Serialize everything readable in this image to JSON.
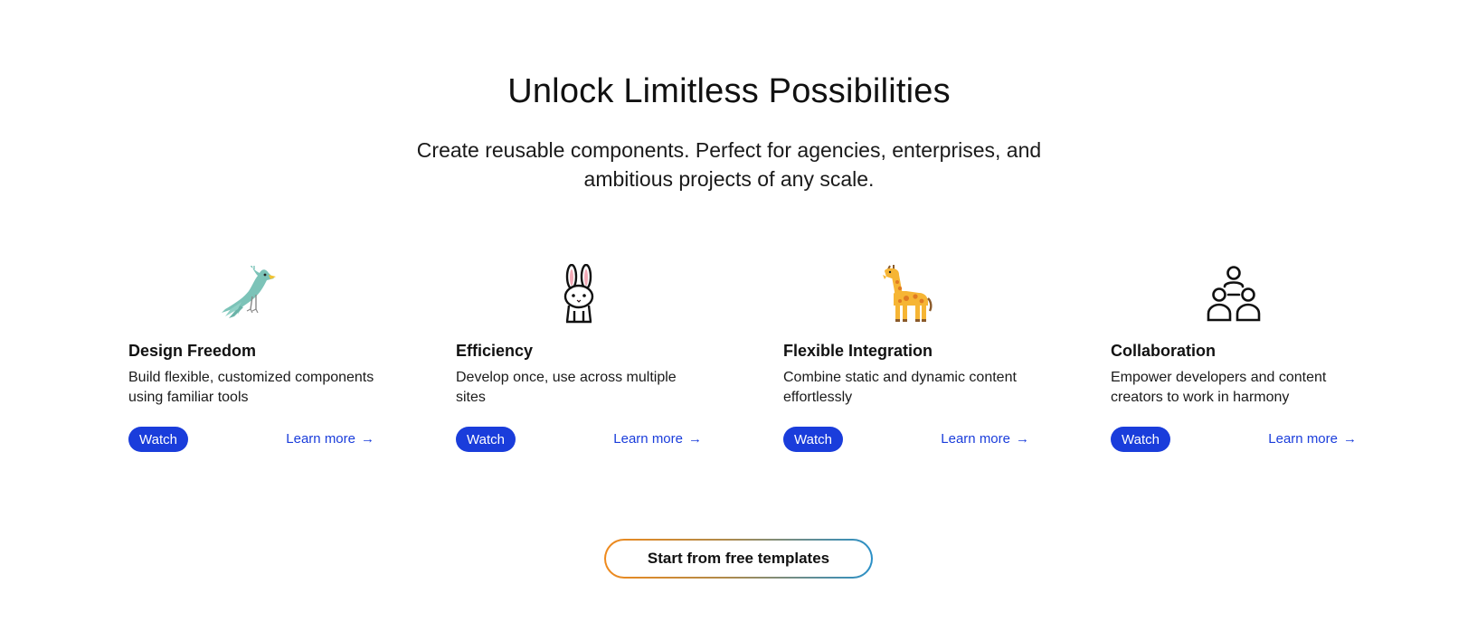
{
  "hero": {
    "title": "Unlock Limitless Possibilities",
    "subtitle": "Create reusable components. Perfect for agencies, enterprises, and ambitious projects of any scale."
  },
  "features": [
    {
      "icon": "bird-icon",
      "title": "Design Freedom",
      "description": "Build flexible, customized components using familiar tools",
      "watch_label": "Watch",
      "learn_label": "Learn more"
    },
    {
      "icon": "rabbit-icon",
      "title": "Efficiency",
      "description": "Develop once, use across multiple sites",
      "watch_label": "Watch",
      "learn_label": "Learn more"
    },
    {
      "icon": "giraffe-icon",
      "title": "Flexible Integration",
      "description": "Combine static and dynamic content effortlessly",
      "watch_label": "Watch",
      "learn_label": "Learn more"
    },
    {
      "icon": "people-group-icon",
      "title": "Collaboration",
      "description": "Empower developers and content creators to work in harmony",
      "watch_label": "Watch",
      "learn_label": "Learn more"
    }
  ],
  "cta": {
    "label": "Start from free templates"
  },
  "colors": {
    "accent": "#1a3ddb",
    "cta_gradient_start": "#f08a1c",
    "cta_gradient_end": "#2a90c8"
  }
}
